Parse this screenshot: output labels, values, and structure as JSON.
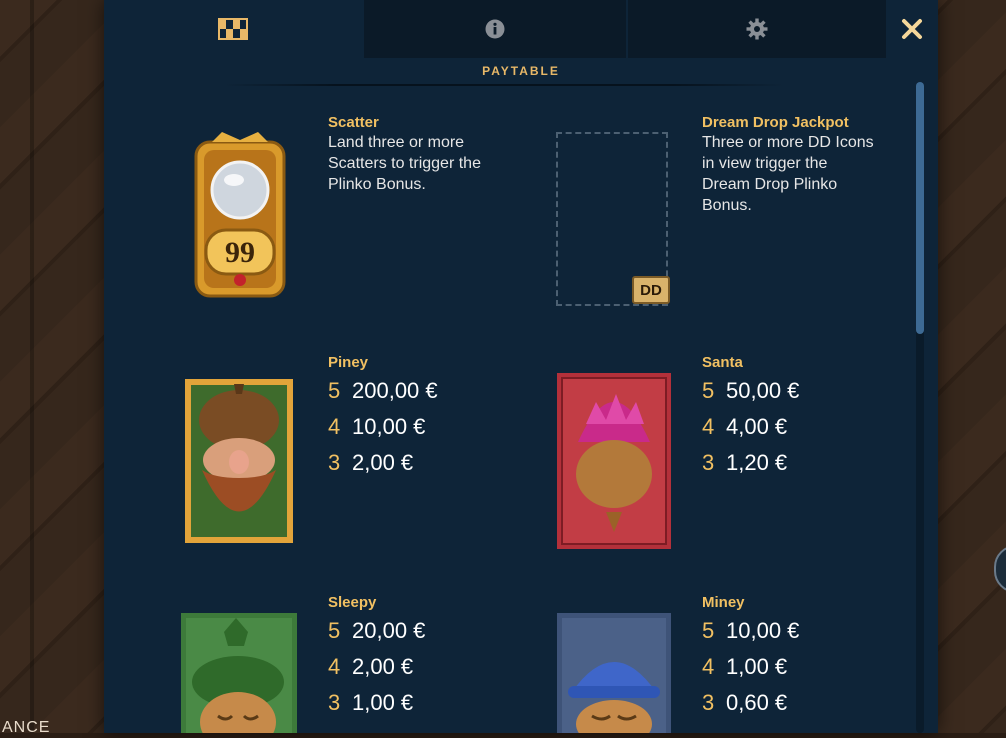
{
  "tabs": [
    {
      "name": "paytable-tab",
      "icon": "checkered-grid-icon"
    },
    {
      "name": "info-tab",
      "icon": "info-icon"
    },
    {
      "name": "settings-tab",
      "icon": "gear-icon"
    }
  ],
  "close_icon": "close-icon",
  "section_title": "PAYTABLE",
  "background_text": "ANCE",
  "colors": {
    "panel": "#0e2438",
    "accent": "#f1c062",
    "scrollbar": "#3d6a94"
  },
  "symbols": {
    "scatter": {
      "name": "Scatter",
      "description": "Land three or more Scatters to trigger the Plinko Bonus.",
      "icon_number": "99"
    },
    "dream_drop": {
      "name": "Dream Drop Jackpot",
      "description": "Three or more DD Icons in view trigger the Dream Drop Plinko Bonus.",
      "badge": "DD"
    },
    "piney": {
      "name": "Piney",
      "pays": [
        {
          "count": "5",
          "amount": "200,00 €"
        },
        {
          "count": "4",
          "amount": "10,00 €"
        },
        {
          "count": "3",
          "amount": "2,00 €"
        }
      ]
    },
    "santa": {
      "name": "Santa",
      "pays": [
        {
          "count": "5",
          "amount": "50,00 €"
        },
        {
          "count": "4",
          "amount": "4,00 €"
        },
        {
          "count": "3",
          "amount": "1,20 €"
        }
      ]
    },
    "sleepy": {
      "name": "Sleepy",
      "pays": [
        {
          "count": "5",
          "amount": "20,00 €"
        },
        {
          "count": "4",
          "amount": "2,00 €"
        },
        {
          "count": "3",
          "amount": "1,00 €"
        }
      ]
    },
    "miney": {
      "name": "Miney",
      "pays": [
        {
          "count": "5",
          "amount": "10,00 €"
        },
        {
          "count": "4",
          "amount": "1,00 €"
        },
        {
          "count": "3",
          "amount": "0,60 €"
        }
      ]
    }
  }
}
